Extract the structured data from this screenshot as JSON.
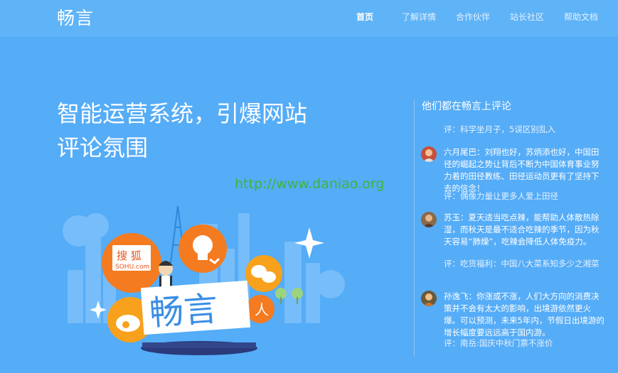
{
  "nav": {
    "logo": "畅言",
    "items": [
      "首页",
      "了解详情",
      "合作伙伴",
      "站长社区",
      "帮助文档"
    ]
  },
  "hero": {
    "line1": "智能运营系统，引爆网站",
    "line2": "评论氛围",
    "watermark": "http://www.daniao.org"
  },
  "illustration": {
    "sohu_text1": "搜 狐",
    "sohu_text2": "SOHU.com",
    "sign_text": "畅言",
    "renren_text": "人"
  },
  "comments": {
    "title": "他们都在畅言上评论",
    "items": [
      {
        "text": "",
        "ref": "评：科学坐月子，5误区别乱入"
      },
      {
        "text": "六月尾巴：刘翔也好，苏炳添也好，中国田径的崛起之势让背后不断为中国体育事业努力着的田径教练、田径运动员更有了坚持下去的信念！",
        "ref": "评：偶像力量让更多人爱上田径"
      },
      {
        "text": "苏玉：夏天适当吃点辣，能帮助人体散热除湿，而秋天是最不适合吃辣的季节，因为秋天容易“肺燥”，吃辣会降低人体免疫力。",
        "ref": "评：吃货福利：中国八大菜系知多少之湘菜"
      },
      {
        "text": "孙逸飞：你涨或不涨，人们大方向的消费决策并不会有太大的影响，出境游依然更火爆。可以预测，未来5年内，节假日出境游的增长幅度要远远高于国内游。",
        "ref": "评：南岳:国庆中秋门票不涨价"
      }
    ]
  },
  "colors": {
    "background": "#55acf7",
    "watermark": "#3db53d",
    "sohu": "#f47b20"
  }
}
